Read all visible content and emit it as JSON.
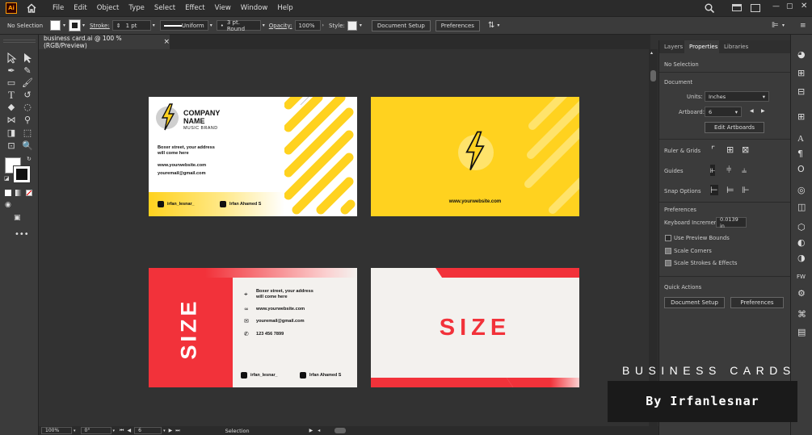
{
  "app": {
    "logo": "Ai"
  },
  "menu": [
    "File",
    "Edit",
    "Object",
    "Type",
    "Select",
    "Effect",
    "View",
    "Window",
    "Help"
  ],
  "control": {
    "selection": "No Selection",
    "stroke_label": "Stroke:",
    "stroke_value": "1 pt",
    "stroke_profile": "Uniform",
    "brush": "3 pt. Round",
    "opacity_label": "Opacity:",
    "opacity_value": "100%",
    "style_label": "Style:",
    "doc_setup": "Document Setup",
    "preferences": "Preferences"
  },
  "doc_tab": {
    "title": "business card.ai @ 100 % (RGB/Preview)",
    "close": "×"
  },
  "panel": {
    "tabs": [
      "Layers",
      "Properties",
      "Libraries"
    ],
    "no_selection": "No Selection",
    "document": "Document",
    "units_label": "Units:",
    "units_value": "Inches",
    "artboard_label": "Artboard:",
    "artboard_value": "6",
    "edit_artboards": "Edit Artboards",
    "ruler_grids": "Ruler & Grids",
    "guides": "Guides",
    "snap": "Snap Options",
    "prefs": "Preferences",
    "kb_label": "Keyboard Increment:",
    "kb_value": "0.0139 in",
    "use_preview": "Use Preview Bounds",
    "scale_corners": "Scale Corners",
    "scale_strokes": "Scale Strokes & Effects",
    "quick_actions": "Quick Actions",
    "doc_setup_btn": "Document Setup",
    "prefs_btn": "Preferences"
  },
  "status": {
    "zoom": "100%",
    "rotate": "0°",
    "artboard": "6",
    "tool": "Selection"
  },
  "card1": {
    "company": "COMPANY",
    "name": "NAME",
    "brand": "MUSIC BRAND",
    "address1": "Boxer street, your address",
    "address2": "will come here",
    "website": "www.yourwebsite.com",
    "email": "youremail@gmail.com",
    "insta": "irfan_lesnar_",
    "linkedin": "Irfan Ahamed S"
  },
  "card2": {
    "website": "www.yourwebsite.com"
  },
  "card3": {
    "logo": "SIZE",
    "address1": "Boxer street, your address",
    "address2": "will come here",
    "website": "www.yourwebsite.com",
    "email": "youremail@gmail.com",
    "phone": "123 456 7899",
    "insta": "irfan_lesnar_",
    "linkedin": "Irfan Ahamed S"
  },
  "card4": {
    "logo": "SIZE"
  },
  "watermark": {
    "line1": "BUSINESS CARDS",
    "line2": "By Irfanlesnar"
  },
  "colors": {
    "yellow": "#ffd21f",
    "red": "#f2323a",
    "cream": "#f3f1ee"
  }
}
